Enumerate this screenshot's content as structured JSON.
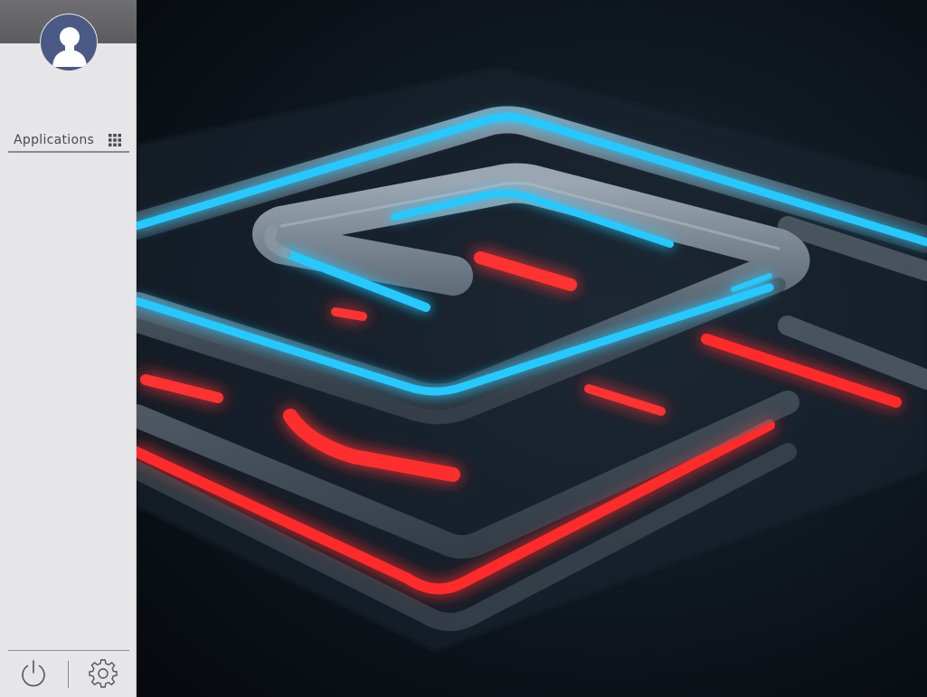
{
  "wallpaper": {
    "description_colors": {
      "glow_blue": "#22c8ff",
      "glow_red": "#ff2a2a",
      "tube": "#7f8d99",
      "background": "#0b1016"
    }
  },
  "sidebar": {
    "avatar_icon": "user-avatar-icon",
    "applications_label": "Applications",
    "applications_icon": "grid-icon",
    "power_icon": "power-icon",
    "settings_icon": "gear-icon"
  },
  "colors": {
    "sidebar_bg": "#e6e6e8",
    "sidebar_header": "#646466",
    "avatar_bg": "#4a5a85",
    "text": "#4a4a4e",
    "divider": "#8b8b8f"
  }
}
